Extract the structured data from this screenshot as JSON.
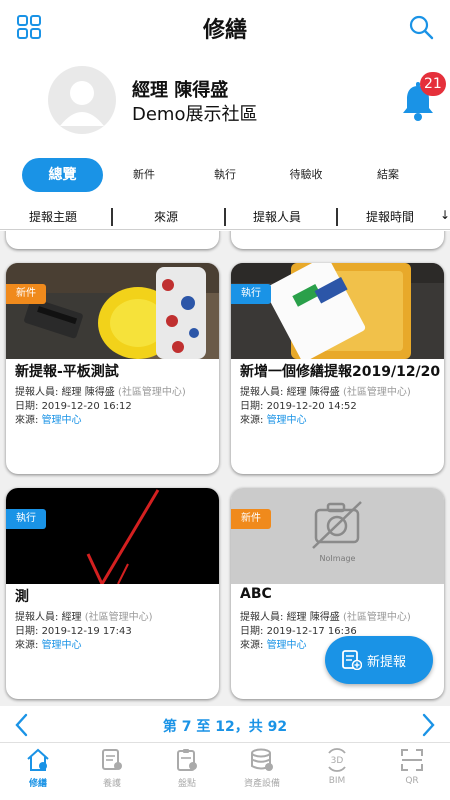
{
  "header": {
    "title": "修繕"
  },
  "profile": {
    "name": "經理 陳得盛",
    "community": "Demo展示社區",
    "notification_count": "21"
  },
  "tabs": [
    {
      "label": "總覽",
      "active": true
    },
    {
      "label": "新件"
    },
    {
      "label": "執行"
    },
    {
      "label": "待驗收"
    },
    {
      "label": "結案"
    }
  ],
  "sort": {
    "items": [
      "提報主題",
      "來源",
      "提報人員",
      "提報時間"
    ],
    "arrow": "↓"
  },
  "cards": [
    {
      "tag": "新件",
      "title": "新提報-平板測試",
      "reporter_label": "提報人員:",
      "reporter": "經理 陳得盛",
      "reporter_org": "(社區管理中心)",
      "date_label": "日期:",
      "date": "2019-12-20 16:12",
      "source_label": "來源:",
      "source": "管理中心"
    },
    {
      "tag": "執行",
      "title": "新增一個修繕提報2019/12/20",
      "reporter_label": "提報人員:",
      "reporter": "經理 陳得盛",
      "reporter_org": "(社區管理中心)",
      "date_label": "日期:",
      "date": "2019-12-20 14:52",
      "source_label": "來源:",
      "source": "管理中心"
    },
    {
      "tag": "執行",
      "title": "測",
      "reporter_label": "提報人員:",
      "reporter": "經理",
      "reporter_org": "(社區管理中心)",
      "date_label": "日期:",
      "date": "2019-12-19 17:43",
      "source_label": "來源:",
      "source": "管理中心"
    },
    {
      "tag": "新件",
      "title": "ABC",
      "reporter_label": "提報人員:",
      "reporter": "經理 陳得盛",
      "reporter_org": "(社區管理中心)",
      "date_label": "日期:",
      "date": "2019-12-17 16:36",
      "source_label": "來源:",
      "source": "管理中心",
      "noimage_text": "NoImage"
    }
  ],
  "fab": {
    "label": "新提報"
  },
  "pager": {
    "text": "第 7 至 12，共 92"
  },
  "bottom_nav": [
    {
      "label": "修繕",
      "icon": "home-repair-icon",
      "active": true
    },
    {
      "label": "養護",
      "icon": "maintenance-doc-icon"
    },
    {
      "label": "盤點",
      "icon": "inventory-clipboard-icon"
    },
    {
      "label": "資產設備",
      "icon": "asset-database-icon"
    },
    {
      "label": "BIM",
      "icon": "bim-3d-icon"
    },
    {
      "label": "QR",
      "icon": "qr-scan-icon"
    }
  ],
  "colors": {
    "accent": "#1a93e6",
    "tag_new": "#f08a1c",
    "tag_exec": "#1a93e6",
    "badge": "#e5303b"
  }
}
